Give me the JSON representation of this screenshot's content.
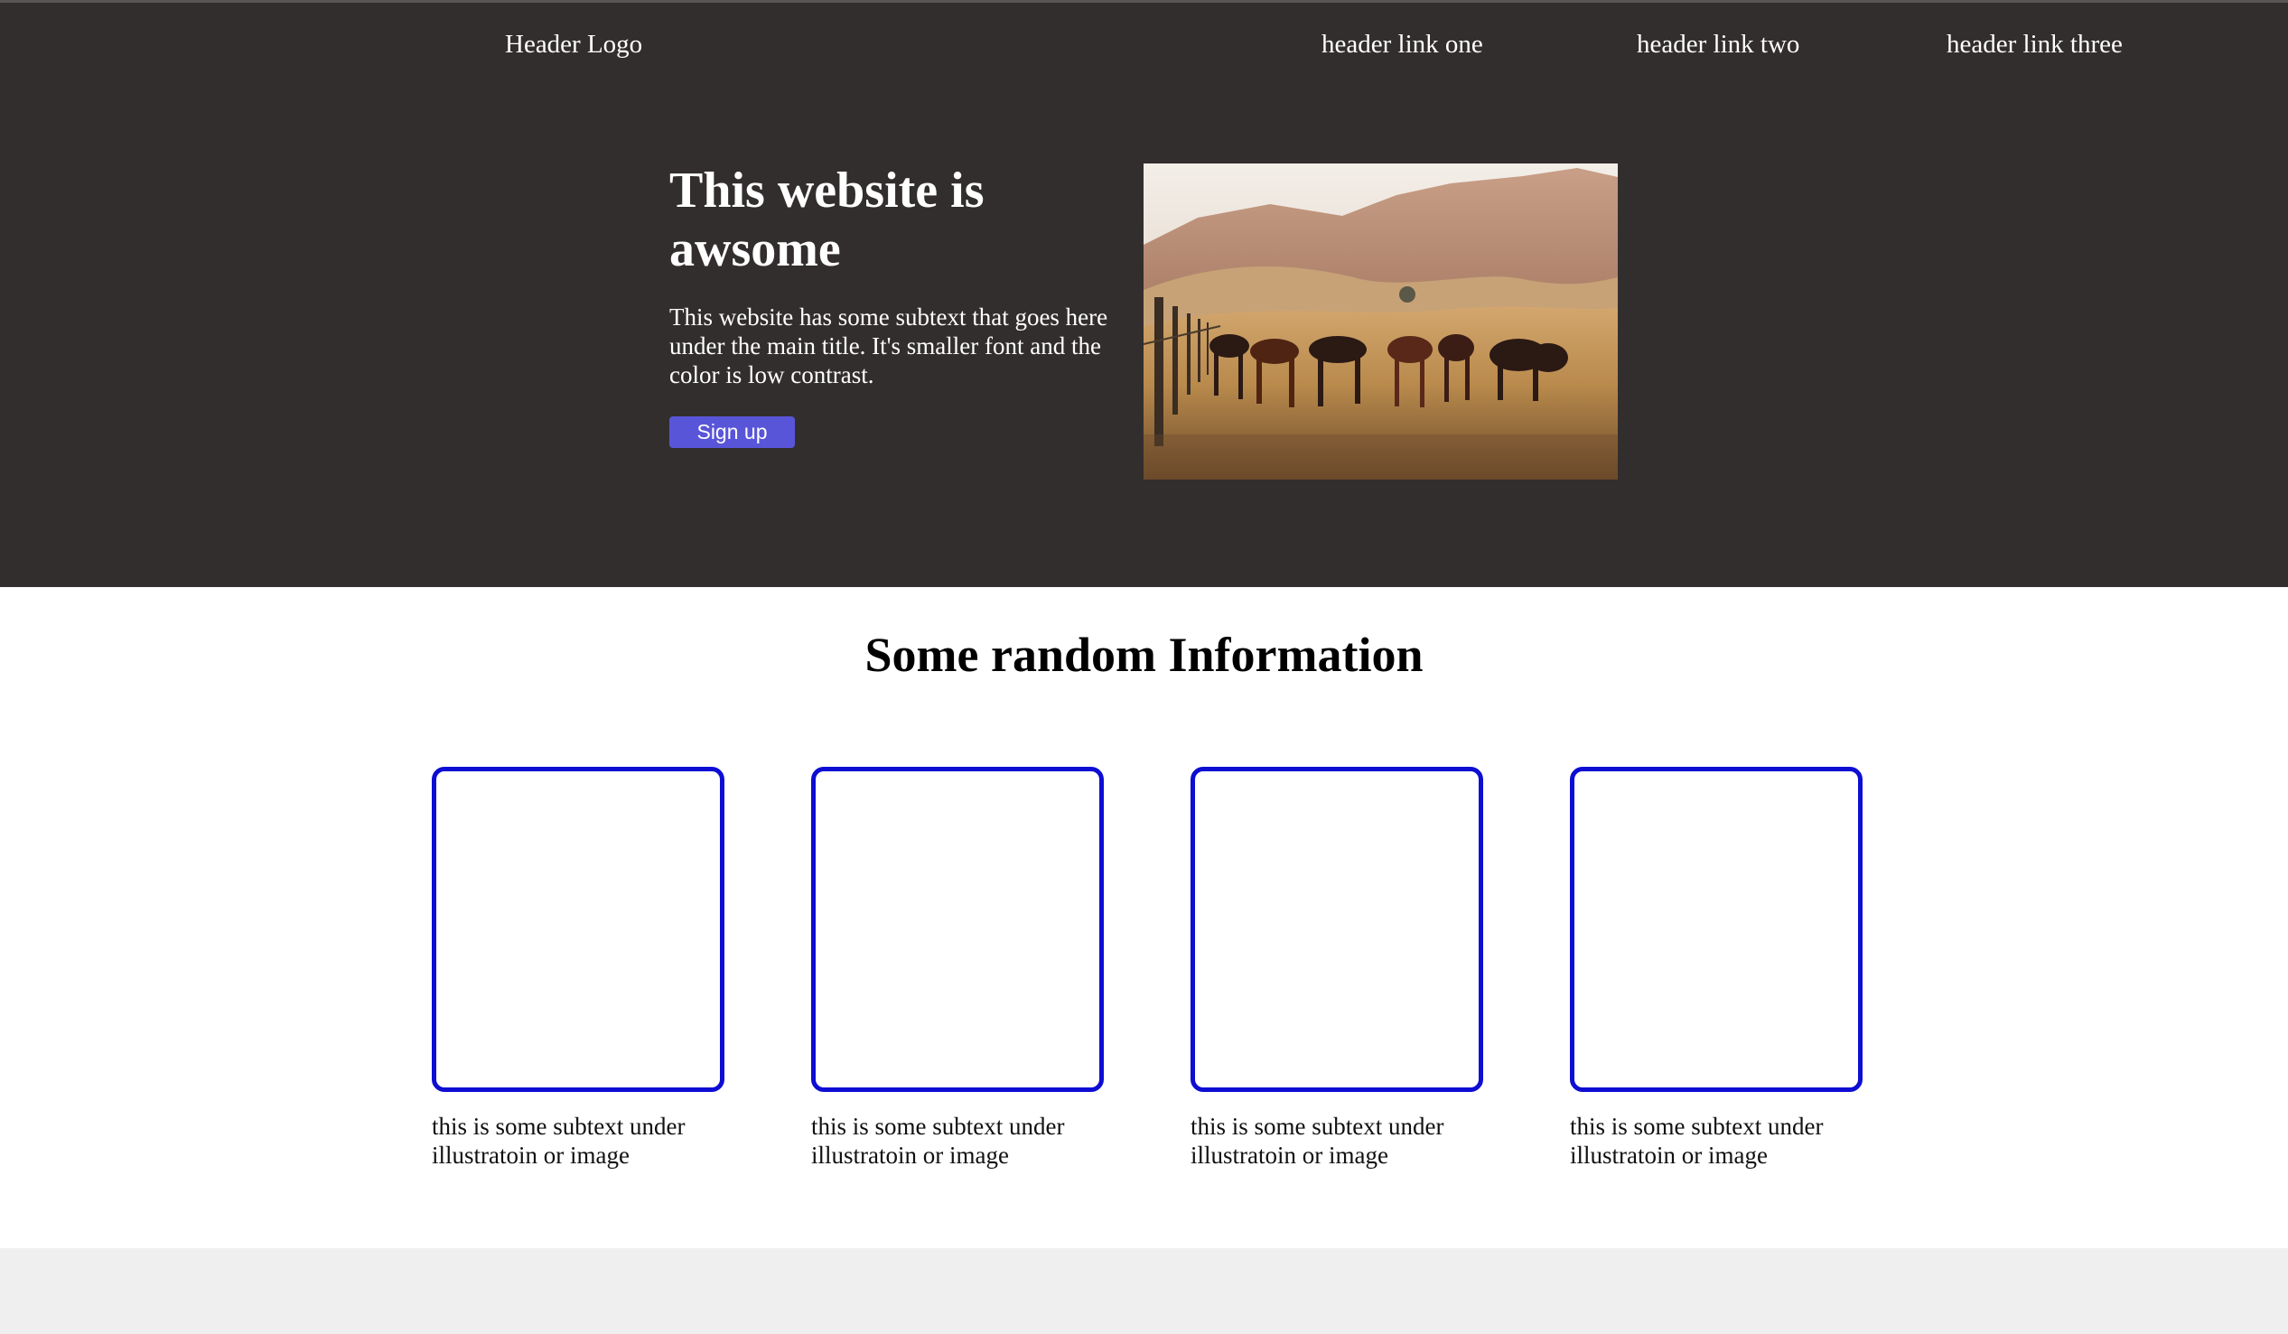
{
  "header": {
    "logo": "Header Logo",
    "links": [
      "header link one",
      "header link two",
      "header link three"
    ]
  },
  "hero": {
    "title": "This website is awsome",
    "subtext": "This website has some subtext that goes here under the main title. It's smaller font and the color is low contrast.",
    "cta_label": "Sign up"
  },
  "info": {
    "title": "Some random Information",
    "cards": [
      {
        "caption": "this is some subtext under illustratoin or image"
      },
      {
        "caption": "this is some subtext under illustratoin or image"
      },
      {
        "caption": "this is some subtext under illustratoin or image"
      },
      {
        "caption": "this is some subtext under illustratoin or image"
      }
    ]
  },
  "colors": {
    "header_background": "#332e2e",
    "button_accent": "#5955d8",
    "card_border": "#0d0dd3",
    "footer_background": "#efefef"
  }
}
